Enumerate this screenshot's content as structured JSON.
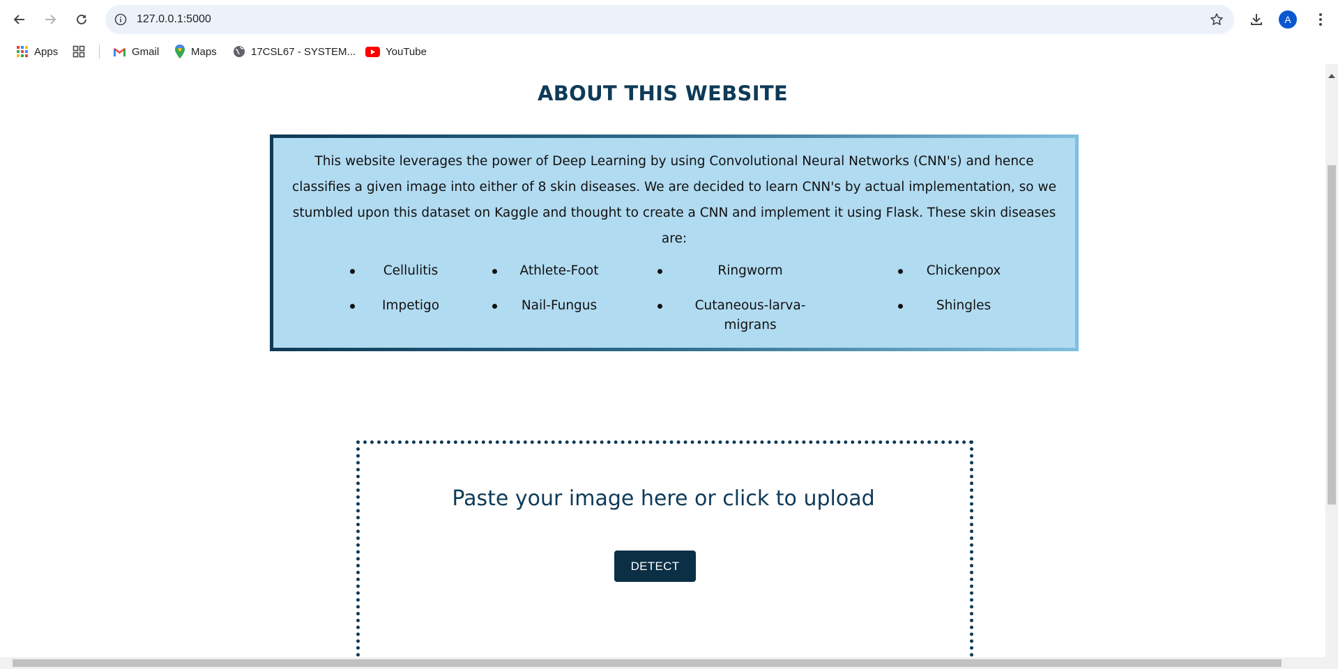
{
  "browser": {
    "url": "127.0.0.1:5000",
    "avatar_letter": "A",
    "bookmarks": [
      {
        "label": "Apps",
        "icon": "apps-grid-icon"
      },
      {
        "label": "",
        "icon": "tab-groups-icon"
      },
      {
        "label": "Gmail",
        "icon": "gmail-icon"
      },
      {
        "label": "Maps",
        "icon": "maps-pin-icon"
      },
      {
        "label": "17CSL67 - SYSTEM...",
        "icon": "globe-icon"
      },
      {
        "label": "YouTube",
        "icon": "youtube-icon"
      }
    ]
  },
  "page": {
    "about_title": "ABOUT THIS WEBSITE",
    "about_text": "This website leverages the power of Deep Learning by using Convolutional Neural Networks (CNN's) and hence classifies a given image into either of 8 skin diseases. We are decided to learn CNN's by actual implementation, so we stumbled upon this dataset on Kaggle and thought to create a CNN and implement it using Flask. These skin diseases are:",
    "diseases": [
      "Cellulitis",
      "Athlete-Foot",
      "Ringworm",
      "Chickenpox",
      "Impetigo",
      "Nail-Fungus",
      "Cutaneous-larva-migrans",
      "Shingles"
    ],
    "upload_prompt": "Paste your image here or click to upload",
    "detect_label": "DETECT"
  },
  "colors": {
    "accent_dark": "#0e3a57",
    "about_box_bg": "#b1dbf1",
    "detect_button": "#0b2f45"
  }
}
